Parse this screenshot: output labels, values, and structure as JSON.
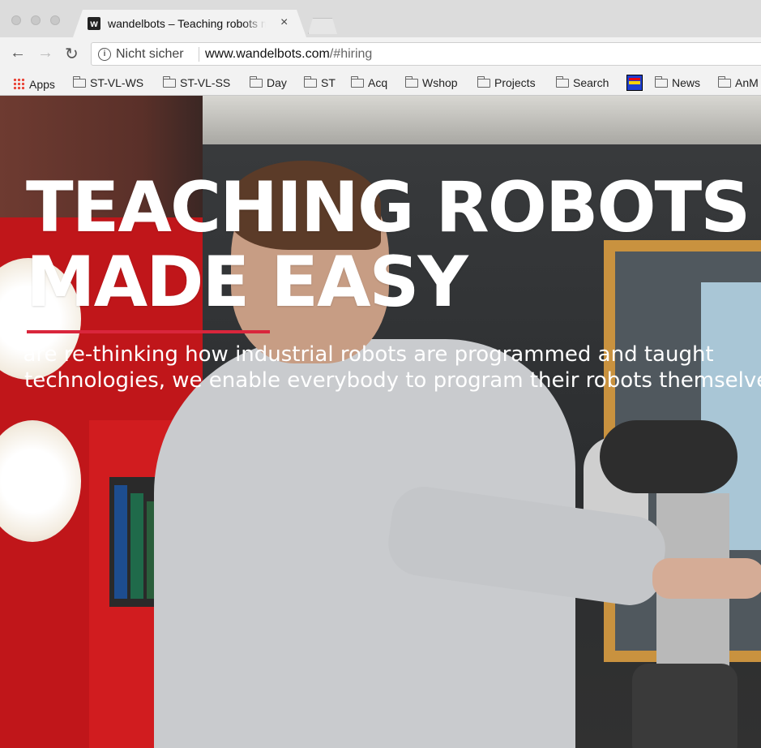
{
  "browser": {
    "tab": {
      "favicon_letter": "w",
      "title": "wandelbots – Teaching robots made easy",
      "close_glyph": "×"
    },
    "nav": {
      "back_glyph": "←",
      "forward_glyph": "→",
      "reload_glyph": "↻"
    },
    "omnibox": {
      "security_label": "Nicht sicher",
      "url_host": "www.wandelbots.com",
      "url_path": "/#hiring"
    },
    "bookmarks": [
      {
        "label": "Apps",
        "icon": "apps-grid-icon"
      },
      {
        "label": "ST-VL-WS",
        "icon": "folder-icon"
      },
      {
        "label": "ST-VL-SS",
        "icon": "folder-icon"
      },
      {
        "label": "Day",
        "icon": "folder-icon"
      },
      {
        "label": "ST",
        "icon": "folder-icon"
      },
      {
        "label": "Acq",
        "icon": "folder-icon"
      },
      {
        "label": "Wshop",
        "icon": "folder-icon"
      },
      {
        "label": "Projects",
        "icon": "folder-icon"
      },
      {
        "label": "Search",
        "icon": "folder-icon"
      },
      {
        "label": "",
        "icon": "flag-icon"
      },
      {
        "label": "News",
        "icon": "folder-icon"
      },
      {
        "label": "AnM",
        "icon": "folder-icon"
      }
    ]
  },
  "hero": {
    "headline_line1": "TEACHING ROBOTS",
    "headline_line2": "MADE EASY",
    "subtitle_line1": "We are re-thinking how industrial robots are programmed and taught",
    "subtitle_line2": "technologies, we enable everybody to program their robots themselves",
    "accent_color": "#d9263c"
  }
}
